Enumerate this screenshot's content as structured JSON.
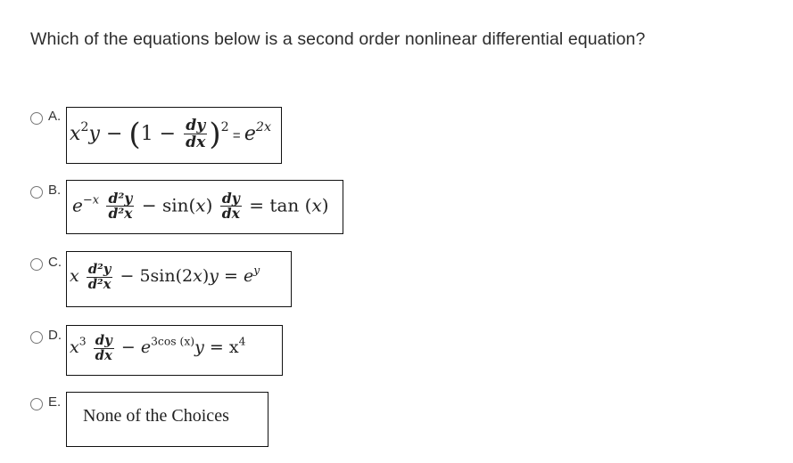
{
  "question": "Which of the equations below is a second order nonlinear differential equation?",
  "options": [
    {
      "letter": "A.",
      "equation_text": "x²y − (1 − dy/dx)² = e^(2x)",
      "parts": {
        "x": "x",
        "x_sup": "2",
        "y_minus": "y −",
        "open": "(",
        "one_minus": "1 −",
        "num": "dy",
        "den": "dx",
        "close": ")",
        "close_sup": "2",
        "eq": " = ",
        "e": "e",
        "e_sup": "2x"
      }
    },
    {
      "letter": "B.",
      "equation_text": "e^(−x) d²y/d²x − sin(x) dy/dx = tan (x)",
      "parts": {
        "e": "e",
        "e_sup": "−x",
        "num1": "d²y",
        "den1": "d²x",
        "minus_sin": " − sin(",
        "x": "x",
        "close": ")",
        "num2": "dy",
        "den2": "dx",
        "eq_tan": " = tan (",
        "x2": "x",
        "close2": ")"
      }
    },
    {
      "letter": "C.",
      "equation_text": "x d²y/d²x − 5sin(2x)y = e^y",
      "parts": {
        "x": "x",
        "num": "d²y",
        "den": "d²x",
        "minus": " − 5sin(2",
        "x2": "x",
        "close": ")",
        "y": "y",
        "eq": " = ",
        "e": "e",
        "e_sup": "y"
      }
    },
    {
      "letter": "D.",
      "equation_text": "x³ dy/dx − e^(3cos (x)) y = x⁴",
      "parts": {
        "x": "x",
        "x_sup": "3",
        "num": "dy",
        "den": "dx",
        "minus": " − ",
        "e": "e",
        "e_sup": "3cos (x)",
        "y": "y",
        "eq": " = x",
        "x4_sup": "4"
      }
    },
    {
      "letter": "E.",
      "equation_text": "None of the Choices"
    }
  ]
}
